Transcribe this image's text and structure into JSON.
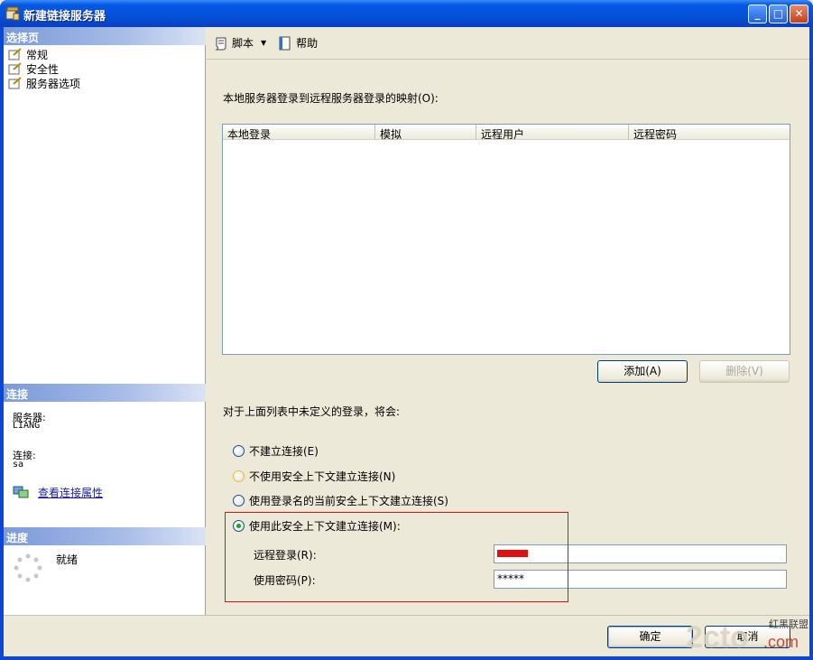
{
  "window": {
    "title": "新建链接服务器",
    "buttons": {
      "minimize": "_",
      "maximize": "□",
      "close": "✕"
    }
  },
  "left": {
    "select_page_header": "选择页",
    "pages": [
      {
        "label": "常规",
        "icon": "page-icon"
      },
      {
        "label": "安全性",
        "icon": "page-icon"
      },
      {
        "label": "服务器选项",
        "icon": "page-icon"
      }
    ],
    "connection_header": "连接",
    "server_label": "服务器:",
    "server_value": "LIANG",
    "connection_label": "连接:",
    "connection_value": "sa",
    "view_props_link": "查看连接属性",
    "progress_header": "进度",
    "progress_status": "就绪"
  },
  "toolbar": {
    "script_label": "脚本",
    "help_label": "帮助"
  },
  "main": {
    "mapping_label": "本地服务器登录到远程服务器登录的映射(O):",
    "grid_columns": [
      "本地登录",
      "模拟",
      "远程用户",
      "远程密码"
    ],
    "add_button": "添加(A)",
    "delete_button": "删除(V)",
    "undefined_label": "对于上面列表中未定义的登录，将会:",
    "options": [
      {
        "label": "不建立连接(E)",
        "selected": false
      },
      {
        "label": "不使用安全上下文建立连接(N)",
        "selected": false
      },
      {
        "label": "使用登录名的当前安全上下文建立连接(S)",
        "selected": false
      },
      {
        "label": "使用此安全上下文建立连接(M):",
        "selected": true
      }
    ],
    "remote_login_label": "远程登录(R):",
    "password_label": "使用密码(P):",
    "password_value": "*****"
  },
  "footer": {
    "ok_button": "确定",
    "cancel_button": "取消"
  },
  "watermark": {
    "text": "2cto",
    "suffix": ".com",
    "site": "红黑联盟"
  },
  "colors": {
    "titlebar": "#0451d8",
    "header": "#7b9ad8",
    "highlight": "#e01010"
  }
}
